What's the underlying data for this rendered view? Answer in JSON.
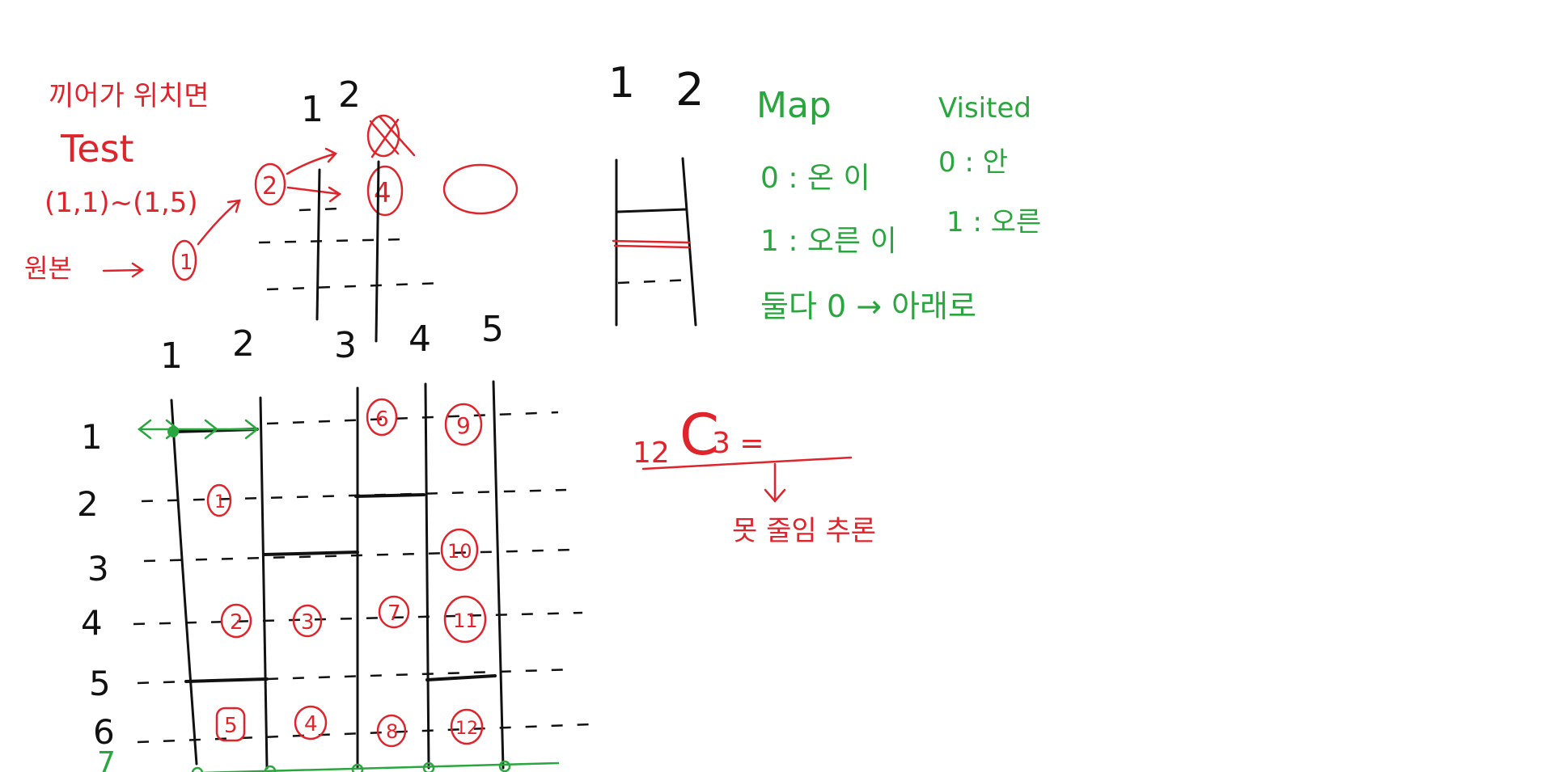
{
  "colors": {
    "ink": "#111111",
    "red": "#e0242b",
    "green": "#2aa63f",
    "background": "#ffffff"
  },
  "notes": {
    "red_title": "끼어가 위치면",
    "test_label": "Test",
    "test_range": "(1,1)~(1,5)",
    "origin_label": "원본",
    "circled_one": "1",
    "circled_two": "2",
    "circled_four": "4",
    "green_map": "Map",
    "green_visited": "Visited",
    "green_row1_left": "0 : 온 이",
    "green_row1_right": "0 : 안",
    "green_row2_left": "1 : 오른 이",
    "green_row2_right": "1 : 오른",
    "green_row3": "둘다 0 → 아래로",
    "combination_left": "12",
    "combination_c": "C",
    "combination_right": "3 =",
    "combination_note": "못 줄임 추론"
  },
  "top_small_ladder": {
    "columns": [
      "1",
      "2"
    ]
  },
  "right_small_ladder": {
    "columns": [
      "1",
      "2"
    ]
  },
  "main_ladder": {
    "columns": [
      "1",
      "2",
      "3",
      "4",
      "5"
    ],
    "rows": [
      "1",
      "2",
      "3",
      "4",
      "5",
      "6",
      "7"
    ],
    "cell_numbers": [
      "1",
      "2",
      "3",
      "4",
      "5",
      "6",
      "7",
      "8",
      "9",
      "10",
      "11",
      "12"
    ]
  }
}
